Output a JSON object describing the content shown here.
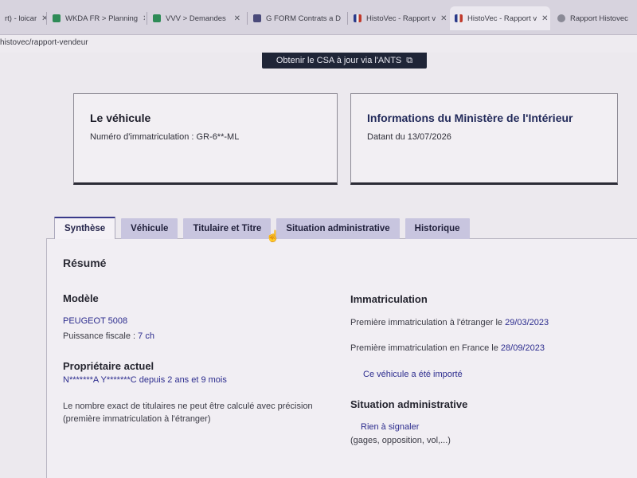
{
  "browser": {
    "tabs": [
      {
        "title": "rt) - loicar",
        "icon_color": "#5b5b8a"
      },
      {
        "title": "WKDA FR > Planning",
        "icon_color": "#2e8b57"
      },
      {
        "title": "VVV > Demandes",
        "icon_color": "#2e8b57"
      },
      {
        "title": "G FORM Contrats a D",
        "icon_color": "#4a4a7a"
      },
      {
        "title": "HistoVec - Rapport v",
        "icon_color": "#c0392b"
      },
      {
        "title": "HistoVec - Rapport v",
        "icon_color": "#c0392b"
      },
      {
        "title": "Rapport Histovec",
        "icon_color": "#6b6b7a"
      }
    ],
    "address": "histovec/rapport-vendeur"
  },
  "page": {
    "csa_button": "Obtenir le CSA à jour via l'ANTS",
    "vehicle_card": {
      "title": "Le véhicule",
      "plate_label": "Numéro d'immatriculation : GR-6**-ML"
    },
    "ministry_card": {
      "title": "Informations du Ministère de l'Intérieur",
      "date_label": "Datant du 13/07/2026"
    },
    "tabs": [
      "Synthèse",
      "Véhicule",
      "Titulaire et Titre",
      "Situation administrative",
      "Historique"
    ],
    "summary": {
      "heading": "Résumé",
      "model": {
        "heading": "Modèle",
        "name": "PEUGEOT 5008",
        "power_label": "Puissance fiscale : ",
        "power_value": "7 ch"
      },
      "owner": {
        "heading": "Propriétaire actuel",
        "name": "N*******A Y*******C",
        "since": " depuis 2 ans et 9 mois",
        "note_line1": "Le nombre exact de titulaires ne peut être calculé avec précision",
        "note_line2": "(première immatriculation à l'étranger)"
      },
      "registration": {
        "heading": "Immatriculation",
        "foreign_label": "Première immatriculation à l'étranger le ",
        "foreign_date": "29/03/2023",
        "france_label": "Première immatriculation en France le ",
        "france_date": "28/09/2023",
        "imported": "Ce véhicule a été importé"
      },
      "admin": {
        "heading": "Situation administrative",
        "status": "Rien à signaler",
        "detail": "(gages, opposition, vol,...)"
      }
    }
  }
}
